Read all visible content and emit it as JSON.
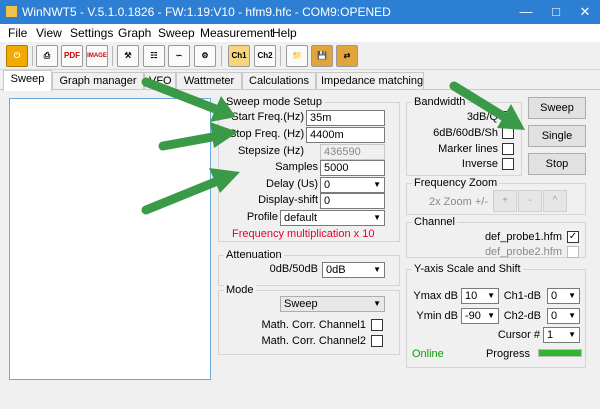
{
  "window": {
    "title": "WinNWT5 - V.5.1.0.1826 - FW:1.19:V10 - hfm9.hfc - COM9:OPENED"
  },
  "menu": [
    "File",
    "View",
    "Settings",
    "Graph",
    "Sweep",
    "Measurement",
    "Help"
  ],
  "toolbar": {
    "pdf_label": "PDF",
    "image_label": "IMAGE",
    "ch1_label": "Ch1",
    "ch2_label": "Ch2"
  },
  "tabs": [
    "Sweep",
    "Graph manager",
    "VFO",
    "Wattmeter",
    "Calculations",
    "Impedance matching"
  ],
  "sweep_setup": {
    "title": "Sweep mode Setup",
    "start_label": "Start Freq.(Hz)",
    "start_value": "35m",
    "stop_label": "Stop Freq. (Hz)",
    "stop_value": "4400m",
    "stepsize_label": "Stepsize (Hz)",
    "stepsize_value": "436590",
    "samples_label": "Samples",
    "samples_value": "5000",
    "delay_label": "Delay (Us)",
    "delay_value": "0",
    "shift_label": "Display-shift",
    "shift_value": "0",
    "profile_label": "Profile",
    "profile_value": "default",
    "freq_mult": "Frequency multiplication x 10"
  },
  "attenuation": {
    "title": "Attenuation",
    "label": "0dB/50dB",
    "value": "0dB"
  },
  "mode": {
    "title": "Mode",
    "value": "Sweep",
    "corr1": "Math. Corr. Channel1",
    "corr2": "Math. Corr. Channel2"
  },
  "bandwidth": {
    "title": "Bandwidth",
    "threedb": "3dB/Q",
    "sixdb": "6dB/60dB/Sh",
    "marker": "Marker lines",
    "inverse": "Inverse"
  },
  "buttons": {
    "sweep": "Sweep",
    "single": "Single",
    "stop": "Stop"
  },
  "zoom": {
    "title": "Frequency Zoom",
    "label": "2x Zoom +/-",
    "plus": "+",
    "minus": "-",
    "up": "^"
  },
  "channel": {
    "title": "Channel",
    "probe1": "def_probe1.hfm",
    "probe2": "def_probe2.hfm"
  },
  "yaxis": {
    "title": "Y-axis Scale and Shift",
    "ymax_label": "Ymax dB",
    "ymax_value": "10",
    "ymin_label": "Ymin dB",
    "ymin_value": "-90",
    "ch1_label": "Ch1-dB",
    "ch1_value": "0",
    "ch2_label": "Ch2-dB",
    "ch2_value": "0",
    "cursor_label": "Cursor #",
    "cursor_value": "1",
    "status": "Online",
    "progress_label": "Progress",
    "progress": 1.0
  },
  "colors": {
    "titlebar": "#2d7fd3",
    "arrow": "#3a9a47",
    "accent_red": "#e8002d",
    "online": "#0a9d0a",
    "progress": "#2fb52f"
  }
}
